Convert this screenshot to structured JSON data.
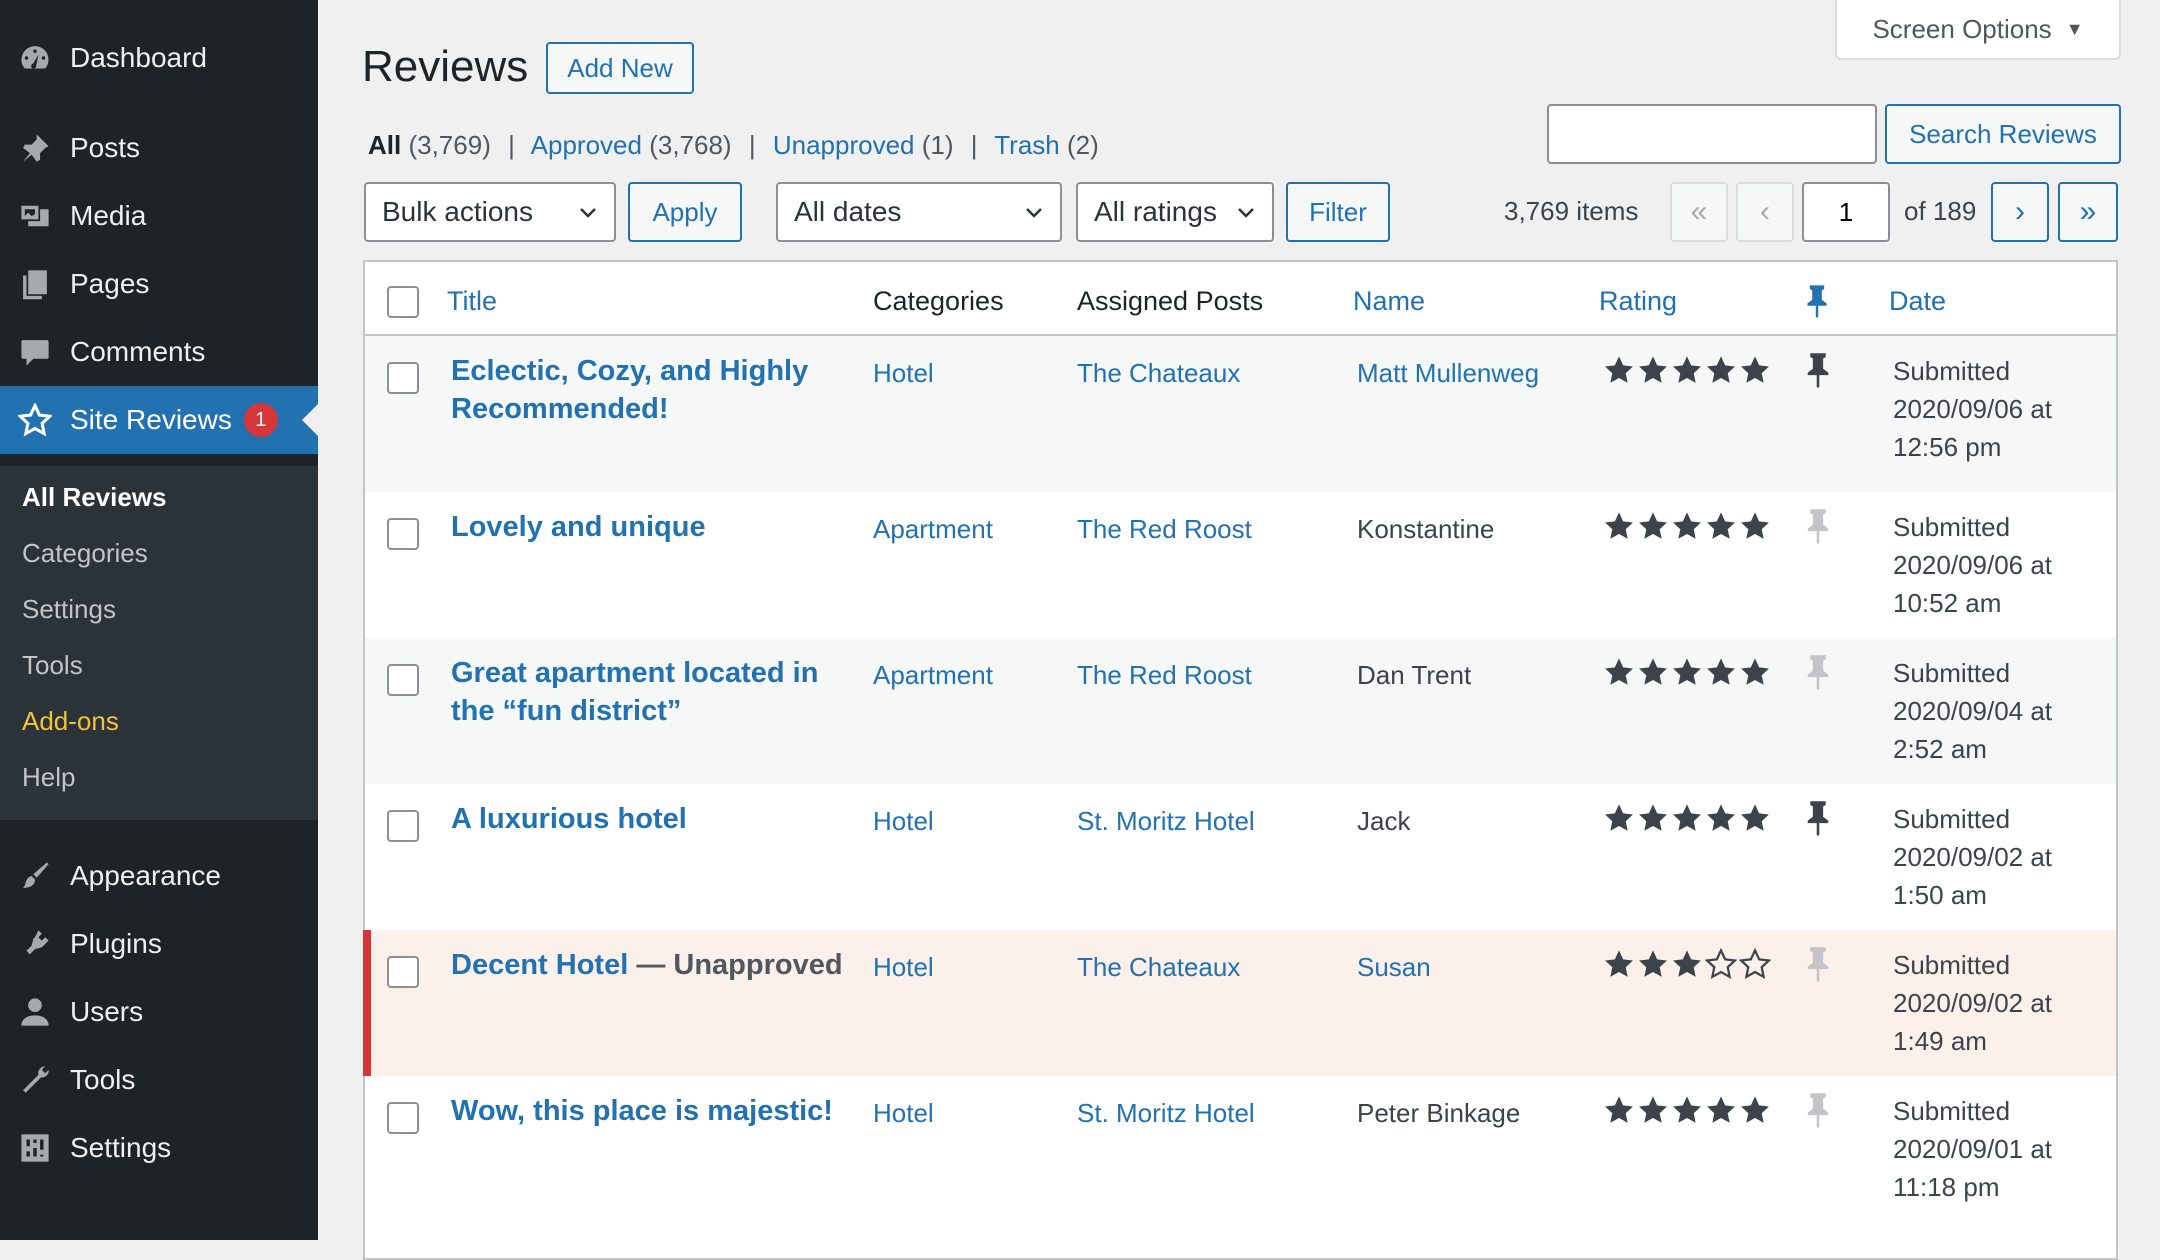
{
  "sidebar": {
    "menu": [
      {
        "label": "Dashboard",
        "icon": "dashboard-icon"
      },
      {
        "label": "Posts",
        "icon": "pin-icon"
      },
      {
        "label": "Media",
        "icon": "media-icon"
      },
      {
        "label": "Pages",
        "icon": "pages-icon"
      },
      {
        "label": "Comments",
        "icon": "comment-icon"
      },
      {
        "label": "Site Reviews",
        "icon": "star-icon",
        "badge": "1"
      }
    ],
    "submenu": [
      "All Reviews",
      "Categories",
      "Settings",
      "Tools",
      "Add-ons",
      "Help"
    ],
    "menu_bottom": [
      {
        "label": "Appearance",
        "icon": "brush-icon"
      },
      {
        "label": "Plugins",
        "icon": "plugin-icon"
      },
      {
        "label": "Users",
        "icon": "user-icon"
      },
      {
        "label": "Tools",
        "icon": "wrench-icon"
      },
      {
        "label": "Settings",
        "icon": "settings-icon"
      }
    ]
  },
  "header": {
    "title": "Reviews",
    "add_new": "Add New",
    "screen_options": "Screen Options"
  },
  "filters": {
    "all": "All",
    "all_count": "(3,769)",
    "approved": "Approved",
    "approved_count": "(3,768)",
    "unapproved": "Unapproved",
    "unapproved_count": "(1)",
    "trash": "Trash",
    "trash_count": "(2)"
  },
  "search": {
    "value": "",
    "button": "Search Reviews"
  },
  "toolbar": {
    "bulk_actions": "Bulk actions",
    "apply": "Apply",
    "dates": "All dates",
    "ratings": "All ratings",
    "filter": "Filter",
    "items": "3,769 items",
    "first": "«",
    "prev": "‹",
    "page": "1",
    "of_pages": "of 189",
    "next": "›",
    "last": "»"
  },
  "columns": [
    "Title",
    "Categories",
    "Assigned Posts",
    "Name",
    "Rating",
    "Date"
  ],
  "reviews": [
    {
      "title": "Eclectic, Cozy, and Highly Recommended!",
      "state": "",
      "category": "Hotel",
      "post": "The Chateaux",
      "name": "Matt Mullenweg",
      "name_link": true,
      "rating": 5,
      "pinned": true,
      "date": "Submitted 2020/09/06 at 12:56 pm"
    },
    {
      "title": "Lovely and unique",
      "state": "",
      "category": "Apartment",
      "post": "The Red Roost",
      "name": "Konstantine",
      "name_link": false,
      "rating": 5,
      "pinned": false,
      "date": "Submitted 2020/09/06 at 10:52 am"
    },
    {
      "title": "Great apartment located in the “fun district”",
      "state": "",
      "category": "Apartment",
      "post": "The Red Roost",
      "name": "Dan Trent",
      "name_link": false,
      "rating": 5,
      "pinned": false,
      "date": "Submitted 2020/09/04 at 2:52 am"
    },
    {
      "title": "A luxurious hotel",
      "state": "",
      "category": "Hotel",
      "post": "St. Moritz Hotel",
      "name": "Jack",
      "name_link": false,
      "rating": 5,
      "pinned": true,
      "date": "Submitted 2020/09/02 at 1:50 am"
    },
    {
      "title": "Decent Hotel",
      "state": " — Unapproved",
      "category": "Hotel",
      "post": "The Chateaux",
      "name": "Susan",
      "name_link": true,
      "rating": 3,
      "pinned": false,
      "date": "Submitted 2020/09/02 at 1:49 am"
    },
    {
      "title": "Wow, this place is majestic!",
      "state": "",
      "category": "Hotel",
      "post": "St. Moritz Hotel",
      "name": "Peter Binkage",
      "name_link": false,
      "rating": 5,
      "pinned": false,
      "date": "Submitted 2020/09/01 at 11:18 pm"
    }
  ],
  "colors": {
    "accent": "#2271b1",
    "sidebar": "#1d2327",
    "unapproved_bar": "#d63638",
    "addons": "#f0c33c"
  }
}
